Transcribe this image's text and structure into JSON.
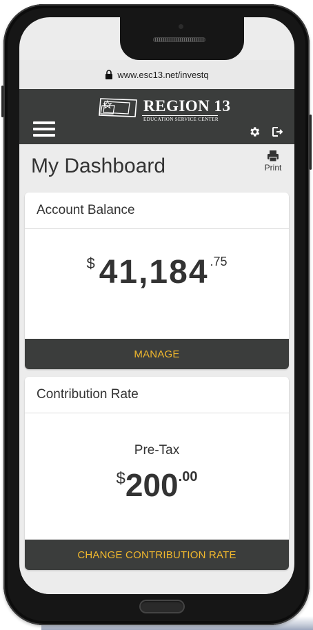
{
  "browser": {
    "url": "www.esc13.net/investq"
  },
  "header": {
    "logo_title": "REGION 13",
    "logo_subtitle": "EDUCATION SERVICE CENTER"
  },
  "page": {
    "title": "My Dashboard",
    "print_label": "Print"
  },
  "account_balance": {
    "title": "Account Balance",
    "currency": "$",
    "amount_main": "41,184",
    "amount_cents": ".75",
    "button_label": "MANAGE"
  },
  "contribution_rate": {
    "title": "Contribution Rate",
    "type_label": "Pre-Tax",
    "currency": "$",
    "amount_main": "200",
    "amount_cents": ".00",
    "button_label": "CHANGE CONTRIBUTION RATE"
  },
  "icons": [
    "lock-icon",
    "hamburger-menu-icon",
    "gear-icon",
    "logout-icon",
    "printer-icon",
    "region13-logo"
  ],
  "colors": {
    "nav_bg": "#3b3d3c",
    "accent": "#f1b82d",
    "page_bg": "#ececec"
  }
}
